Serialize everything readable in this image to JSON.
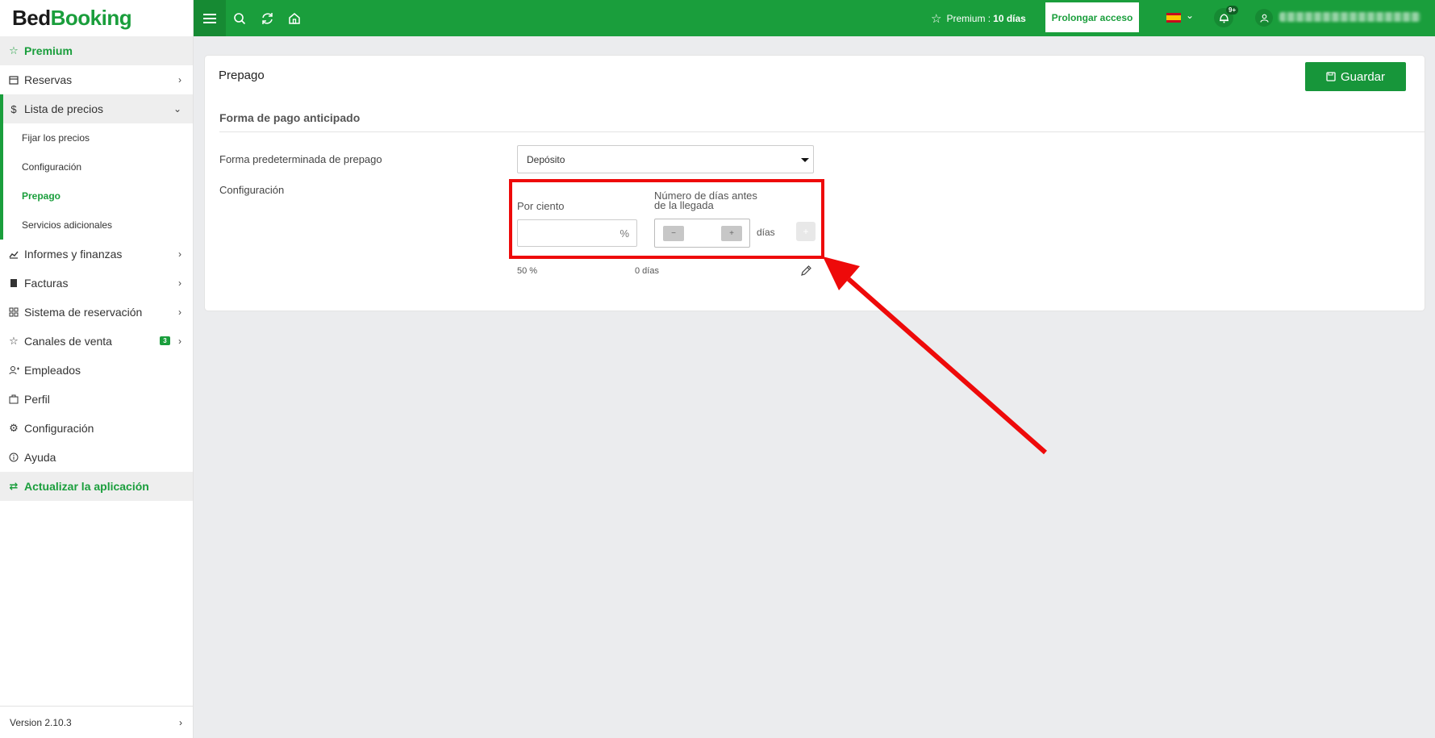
{
  "app": {
    "logo_bed": "Bed",
    "logo_booking": "Booking",
    "version": "Version 2.10.3"
  },
  "sidebar": {
    "premium": "Premium",
    "items": [
      {
        "label": "Reservas"
      },
      {
        "label": "Lista de precios"
      },
      {
        "label": "Informes y finanzas"
      },
      {
        "label": "Facturas"
      },
      {
        "label": "Sistema de reservación"
      },
      {
        "label": "Canales de venta",
        "badge": "3"
      },
      {
        "label": "Empleados"
      },
      {
        "label": "Perfil"
      },
      {
        "label": "Configuración"
      },
      {
        "label": "Ayuda"
      }
    ],
    "sub_items": [
      {
        "label": "Fijar los precios"
      },
      {
        "label": "Configuración"
      },
      {
        "label": "Prepago"
      },
      {
        "label": "Servicios adicionales"
      }
    ],
    "update_app": "Actualizar la aplicación"
  },
  "topbar": {
    "premium_label": "Premium :",
    "premium_days": "10 días",
    "prolong_button": "Prolongar acceso",
    "notifications_badge": "9+",
    "user_name": "hidden"
  },
  "page": {
    "title": "Prepago",
    "save_button": "Guardar",
    "section_title": "Forma de pago anticipado",
    "default_label": "Forma predeterminada de prepago",
    "default_value": "Depósito",
    "config_label": "Configuración",
    "percent_label": "Por ciento",
    "percent_symbol": "%",
    "days_label_line1": "Número de días antes",
    "days_label_line2": "de la llegada",
    "days_unit": "días",
    "minus": "−",
    "plus": "+",
    "add": "+",
    "row_percent": "50 %",
    "row_days": "0 días"
  },
  "colors": {
    "brand": "#1a9e3c",
    "annotation": "#ee0a0a"
  }
}
